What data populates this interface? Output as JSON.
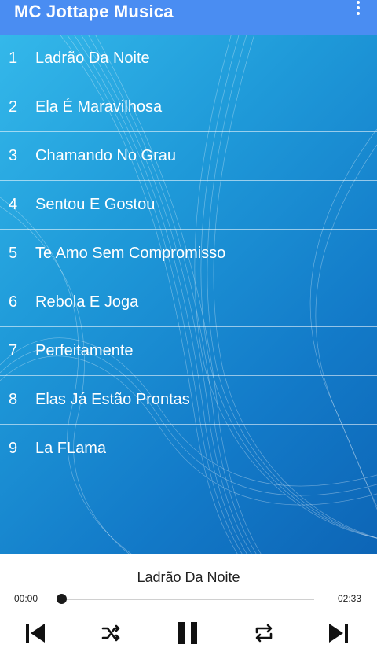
{
  "app": {
    "title": "MC Jottape Musica"
  },
  "songs": [
    {
      "number": "1",
      "title": "Ladrão Da Noite"
    },
    {
      "number": "2",
      "title": "Ela É Maravilhosa"
    },
    {
      "number": "3",
      "title": "Chamando No Grau"
    },
    {
      "number": "4",
      "title": "Sentou E Gostou"
    },
    {
      "number": "5",
      "title": "Te Amo Sem Compromisso"
    },
    {
      "number": "6",
      "title": "Rebola E Joga"
    },
    {
      "number": "7",
      "title": "Perfeitamente"
    },
    {
      "number": "8",
      "title": "Elas Já Estão Prontas"
    },
    {
      "number": "9",
      "title": "La FLama"
    }
  ],
  "player": {
    "now_playing": "Ladrão Da Noite",
    "current_time": "00:00",
    "duration": "02:33",
    "progress": 0
  },
  "colors": {
    "appbar": "#4a8df2",
    "list_bg_light": "#34b8ea",
    "list_bg_dark": "#0d65b6"
  },
  "icons": {
    "menu": "more-vert-icon",
    "previous": "skip-previous-icon",
    "shuffle": "shuffle-icon",
    "pause": "pause-icon",
    "repeat": "repeat-icon",
    "next": "skip-next-icon"
  }
}
